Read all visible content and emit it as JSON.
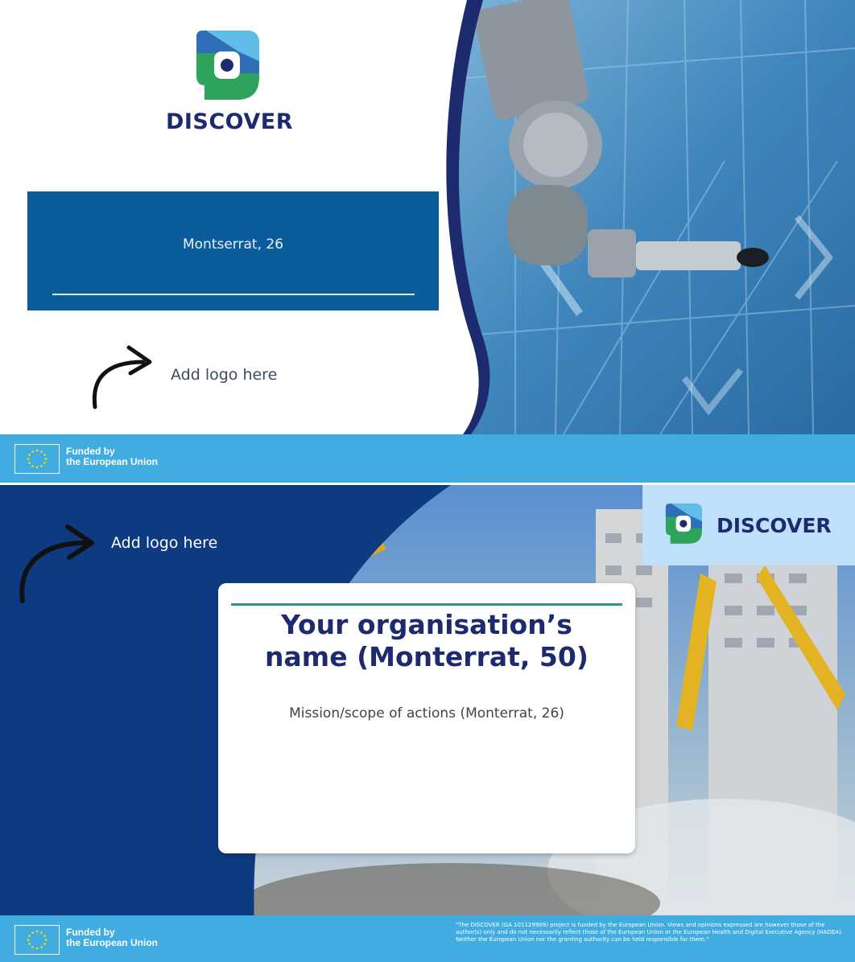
{
  "slide1": {
    "logo_word": "DISCOVER",
    "title_text": "Montserrat, 26",
    "add_logo": "Add logo here",
    "footer": {
      "line1": "Funded by",
      "line2": "the European Union"
    }
  },
  "slide2": {
    "add_logo": "Add logo here",
    "logo_word": "DISCOVER",
    "card_title_line1": "Your organisation’s",
    "card_title_line2": "name (Monterrat, 50)",
    "card_subtitle": "Mission/scope of actions (Monterrat, 26)",
    "footer": {
      "line1": "Funded by",
      "line2": "the European Union",
      "disclaimer": "\"The DISCOVER (GA 101129909) project is funded by the European Union. Views and opinions expressed are however those of the author(s) only and do not necessarily reflect those of the European Union or the European Health and Digital Executive Agency (HADEA). Neither the European Union nor the granting authority can be held responsible for them.\""
    }
  },
  "colors": {
    "navy": "#1d2b6e",
    "deep_blue": "#0e3a82",
    "title_blue": "#0a5c9a",
    "sky": "#41ace0",
    "teal": "#2a9a86"
  },
  "icons": [
    "discover-logo-icon",
    "arrow-icon",
    "eu-flag-icon",
    "robot-arm-image",
    "demolition-image"
  ]
}
